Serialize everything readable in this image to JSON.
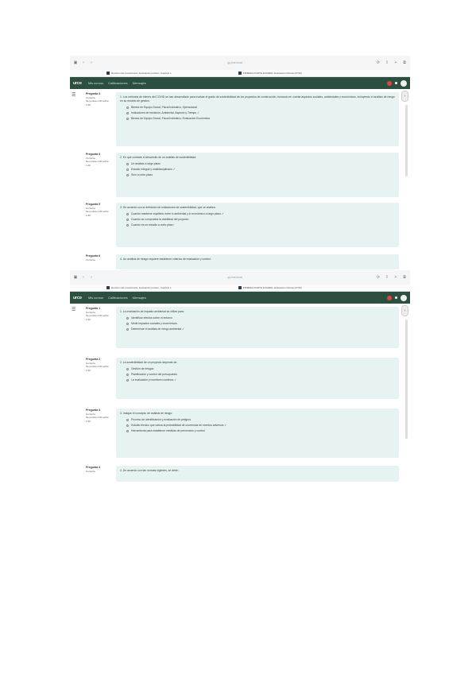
{
  "browser": {
    "nav_symbols": [
      "▣",
      "‹",
      "›"
    ],
    "url": "qq.lms.local",
    "right_icons": [
      "⟳",
      "⇧",
      "+",
      "⧉"
    ],
    "tab1_title": "Revisión del cuestionario: Evaluación parcial - Capítulo 1",
    "tab2_title": "PRIMERA PARTE EXAMEN: Evaluación Parcial (27/10)"
  },
  "app": {
    "brand": "urco",
    "nav": [
      "Mis cursos",
      "Calificaciones",
      "Mensajes"
    ],
    "menu_icon": "☰",
    "collapse_icon": "‹"
  },
  "shot1": {
    "questions": [
      {
        "number": "Pregunta 3",
        "state": "Correcta",
        "score": "Se puntúa 1,00 sobre 1,00",
        "text": "1. Los métodos de interés del COVID se han desarrollado para evaluar el grado de sostenibilidad de los proyectos de construcción, tomando en cuenta aspectos sociales, ambientales y económicos, incluyendo el análisis de riesgo en su modelo de gestión.",
        "options": [
          "Bienes de Equipo Social, Fiscal Indicativo, Operacional",
          "Indicadores de medición, Ambiental, Aspecto y Tiempo ✓",
          "Bienes de Equipo Social, Fiscal Indicativo, Evaluación Económica"
        ]
      },
      {
        "number": "Pregunta 4",
        "state": "Correcta",
        "score": "Se puntúa 1,00 sobre 1,00",
        "text": "2. En qué consiste el desarrollo de un análisis de sostenibilidad:",
        "options": [
          "Un análisis a largo plazo",
          "Estudio integral y multidisciplinario ✓",
          "Solo a corto plazo"
        ]
      },
      {
        "number": "Pregunta 5",
        "state": "Correcta",
        "score": "Se puntúa 1,00 sobre 1,00",
        "text": "3. De acuerdo con la definición de indicadores de sostenibilidad, qué se analiza:",
        "options": [
          "Cuando mantiene equilibrio entre lo ambiental y lo económico a largo plazo ✓",
          "Cuando se comprueba la viabilidad del proyecto",
          "Cuando es un estudio a corto plazo"
        ]
      },
      {
        "number": "Pregunta 6",
        "state": "Correcta",
        "score": "",
        "text": "4. Un análisis de riesgo requiere establecer criterios de evaluación y control:",
        "options": []
      }
    ]
  },
  "shot2": {
    "questions": [
      {
        "number": "Pregunta 1",
        "state": "Correcta",
        "score": "Se puntúa 1,00 sobre 1,00",
        "text": "1. La evaluación de impacto ambiental se utiliza para:",
        "options": [
          "Identificar efectos sobre el entorno",
          "Medir impactos sociales y económicos",
          "Determinar el análisis de riesgo ambiental ✓"
        ]
      },
      {
        "number": "Pregunta 2",
        "state": "Correcta",
        "score": "Se puntúa 1,00 sobre 1,00",
        "text": "2. La sostenibilidad de un proyecto depende de:",
        "options": [
          "Gestión de riesgos",
          "Planificación y control del presupuesto",
          "La evaluación y monitoreo continuo ✓"
        ]
      },
      {
        "number": "Pregunta 3",
        "state": "Correcta",
        "score": "Se puntúa 1,00 sobre 1,00",
        "text": "3. Indique el concepto de análisis de riesgo:",
        "options": [
          "Proceso de identificación y evaluación de peligros",
          "Estudio técnico que valora la probabilidad de ocurrencia de eventos adversos ✓",
          "Herramienta para establecer medidas de prevención y control"
        ]
      },
      {
        "number": "Pregunta 4",
        "state": "Correcta",
        "score": "",
        "text": "4. De acuerdo con las normas vigentes, se debe:",
        "options": []
      }
    ]
  }
}
